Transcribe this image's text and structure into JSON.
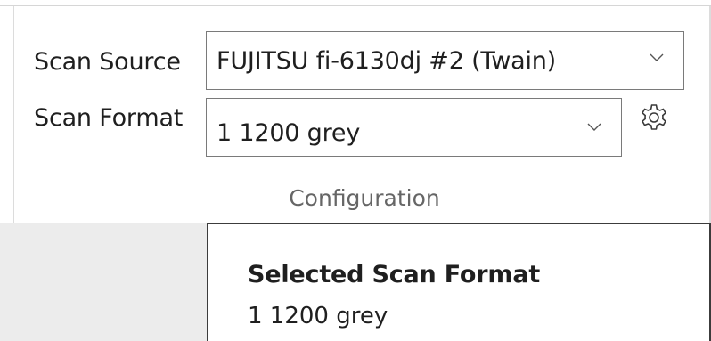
{
  "configuration": {
    "scan_source": {
      "label": "Scan Source",
      "selected": "FUJITSU fi-6130dj #2 (Twain)",
      "dropdown_icon": "chevron-down-icon"
    },
    "scan_format": {
      "label": "Scan Format",
      "selected": "1 1200 grey",
      "dropdown_icon": "chevron-down-icon",
      "settings_icon": "gear-icon"
    },
    "group_caption": "Configuration"
  },
  "selected_panel": {
    "title": "Selected Scan Format",
    "value": "1 1200 grey"
  },
  "colors": {
    "border": "#7a7a7a",
    "caption": "#666666",
    "panel_border": "#3c3c3c",
    "side_background": "#ececec"
  }
}
